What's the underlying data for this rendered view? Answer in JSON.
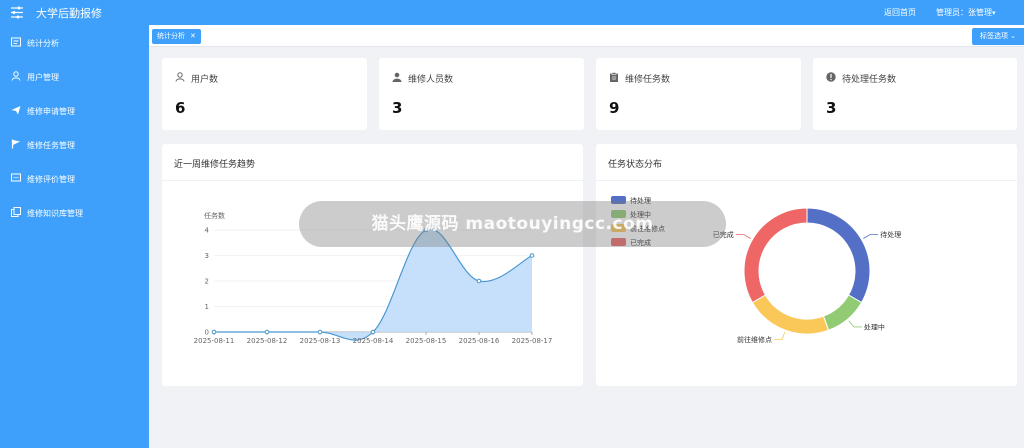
{
  "header": {
    "app_title": "大学后勤报修",
    "home_link": "返回首页",
    "admin_label": "管理员：张管理",
    "caret": "▾"
  },
  "sidebar": {
    "items": [
      {
        "label": "统计分析",
        "icon": "chart-icon"
      },
      {
        "label": "用户管理",
        "icon": "user-icon"
      },
      {
        "label": "维修申请管理",
        "icon": "send-icon"
      },
      {
        "label": "维修任务管理",
        "icon": "flag-icon"
      },
      {
        "label": "维修评价管理",
        "icon": "comment-icon"
      },
      {
        "label": "维修知识库管理",
        "icon": "copy-icon"
      }
    ]
  },
  "tabs": {
    "active_tab": "统计分析",
    "close": "✕",
    "options": "标签选项 ⌄"
  },
  "stats": [
    {
      "label": "用户数",
      "value": "6",
      "icon": "user-icon"
    },
    {
      "label": "维修人员数",
      "value": "3",
      "icon": "worker-icon"
    },
    {
      "label": "维修任务数",
      "value": "9",
      "icon": "clipboard-icon"
    },
    {
      "label": "待处理任务数",
      "value": "3",
      "icon": "alert-icon"
    }
  ],
  "trend_panel": {
    "title": "近一周维修任务趋势"
  },
  "status_panel": {
    "title": "任务状态分布"
  },
  "watermark": "猫头鹰源码 maotouyingcc.com",
  "colors": {
    "accent": "#3ea0fb",
    "line": "#4a97d0",
    "area": "#bcdbfb"
  },
  "chart_data": [
    {
      "type": "area",
      "ylabel": "任务数",
      "categories": [
        "2025-08-11",
        "2025-08-12",
        "2025-08-13",
        "2025-08-14",
        "2025-08-15",
        "2025-08-16",
        "2025-08-17"
      ],
      "values": [
        0,
        0,
        0,
        0,
        4,
        2,
        3
      ],
      "ylim": [
        0,
        4
      ],
      "yticks": [
        0,
        1,
        2,
        3,
        4
      ],
      "grid": true,
      "smooth": true
    },
    {
      "type": "pie",
      "donut": true,
      "legend_position": "top-left",
      "slices": [
        {
          "label": "待处理",
          "value": 3,
          "color": "#5470c6"
        },
        {
          "label": "处理中",
          "value": 1,
          "color": "#91cc75"
        },
        {
          "label": "前往维修点",
          "value": 2,
          "color": "#fac858"
        },
        {
          "label": "已完成",
          "value": 3,
          "color": "#ee6666"
        }
      ]
    }
  ]
}
